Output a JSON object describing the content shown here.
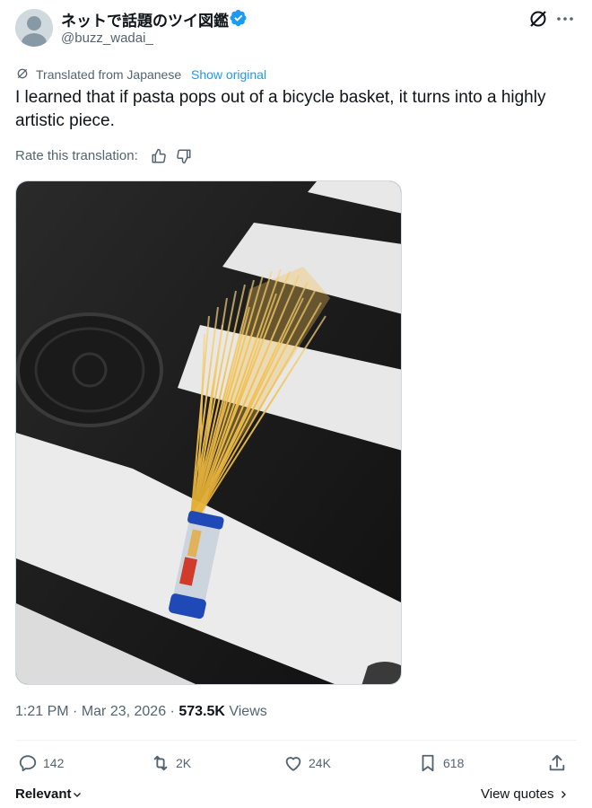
{
  "author": {
    "display_name": "ネットで話題のツイ図鑑",
    "handle": "@buzz_wadai_"
  },
  "translation": {
    "translated_from": "Translated from Japanese",
    "show_original": "Show original",
    "rate_label": "Rate this translation:"
  },
  "tweet": {
    "text": "I learned that if pasta pops out of a bicycle basket, it turns into a highly artistic piece."
  },
  "meta": {
    "time": "1:21 PM",
    "sep1": " · ",
    "date": "Mar 23, 2026",
    "sep2": " · ",
    "views_count": "573.5K",
    "views_label": " Views"
  },
  "actions": {
    "replies": "142",
    "reposts": "2K",
    "likes": "24K",
    "bookmarks": "618"
  },
  "footer": {
    "sort_label": "Relevant",
    "view_quotes": "View quotes"
  },
  "colors": {
    "accent": "#1d9bf0",
    "text": "#0f1419",
    "muted": "#536471"
  },
  "icons": [
    "verified-badge-icon",
    "grok-icon",
    "more-icon",
    "translate-icon",
    "thumbs-up-icon",
    "thumbs-down-icon",
    "reply-icon",
    "repost-icon",
    "like-icon",
    "bookmark-icon",
    "share-icon",
    "chevron-down-icon",
    "chevron-right-icon"
  ]
}
